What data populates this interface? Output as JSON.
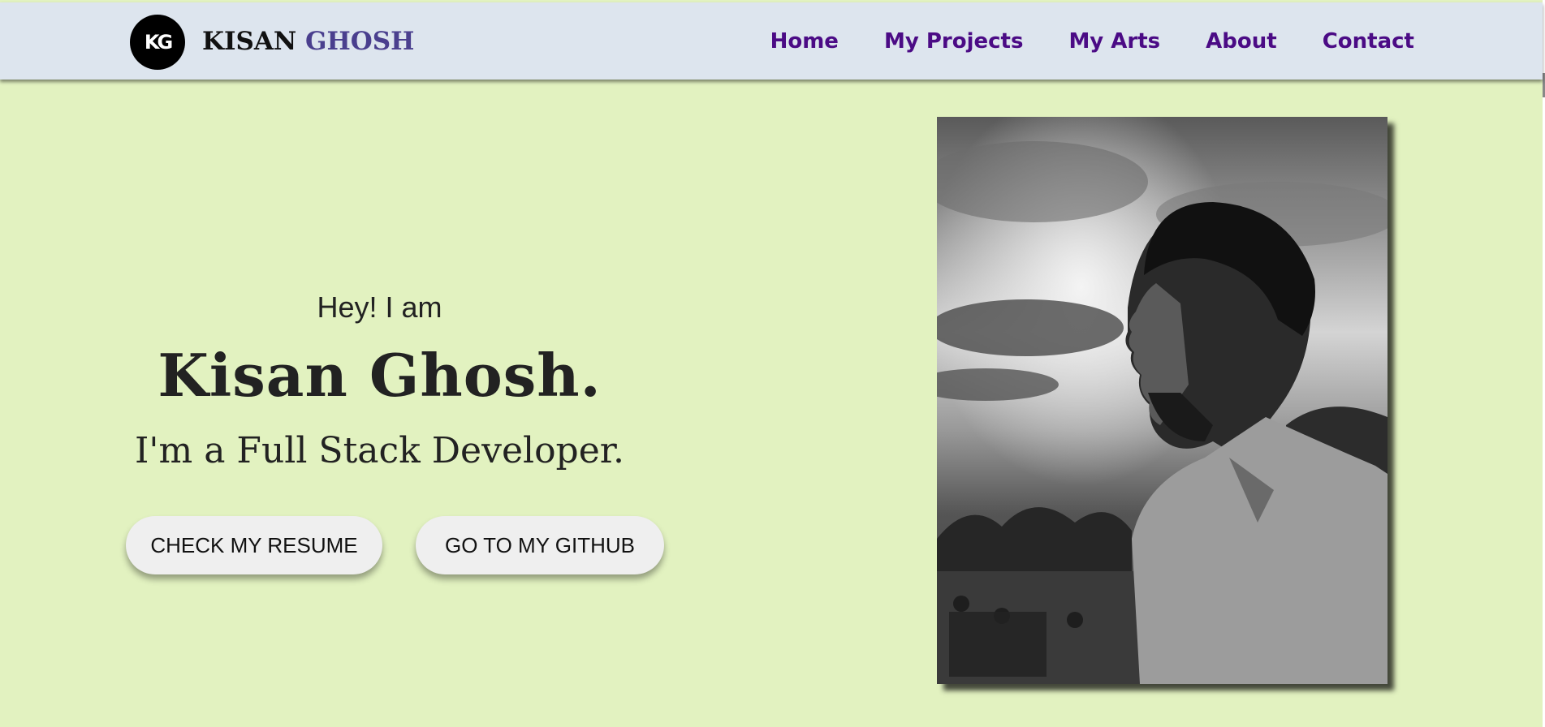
{
  "brand": {
    "logo_text": "KG",
    "name_first": "KISAN",
    "name_last": "GHOSH"
  },
  "nav": {
    "items": [
      "Home",
      "My Projects",
      "My Arts",
      "About",
      "Contact"
    ]
  },
  "hero": {
    "greeting": "Hey! I am",
    "name": "Kisan Ghosh.",
    "role": "I'm a Full Stack Developer.",
    "resume_button": "CHECK MY RESUME",
    "github_button": "GO TO MY GITHUB"
  },
  "colors": {
    "background": "#e2f2c0",
    "navbar": "#dde5ee",
    "nav_link": "#4b0b85",
    "brand_accent": "#4a3f8e"
  }
}
